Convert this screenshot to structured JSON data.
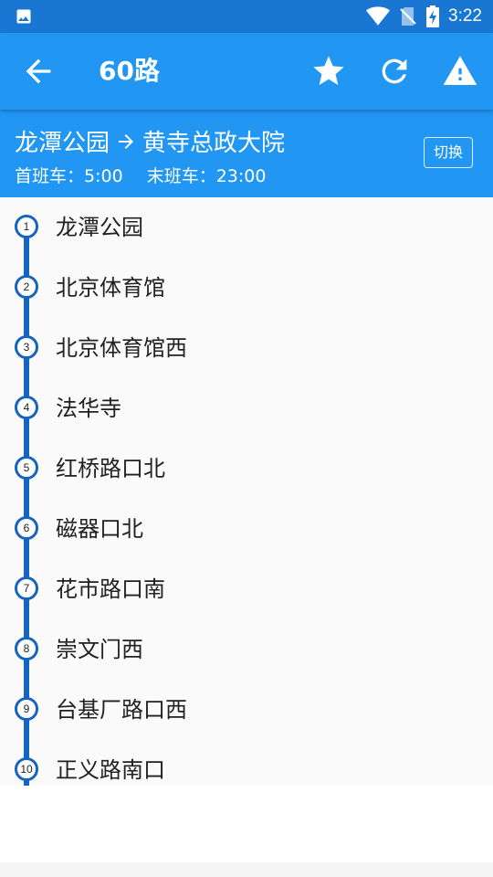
{
  "status_bar": {
    "time": "3:22"
  },
  "app_bar": {
    "title": "60路"
  },
  "route": {
    "from": "龙潭公园",
    "to": "黄寺总政大院",
    "first_bus": "首班车：5:00",
    "last_bus": "末班车：23:00",
    "switch_label": "切换"
  },
  "stops": [
    {
      "num": "1",
      "name": "龙潭公园"
    },
    {
      "num": "2",
      "name": "北京体育馆"
    },
    {
      "num": "3",
      "name": "北京体育馆西"
    },
    {
      "num": "4",
      "name": "法华寺"
    },
    {
      "num": "5",
      "name": "红桥路口北"
    },
    {
      "num": "6",
      "name": "磁器口北"
    },
    {
      "num": "7",
      "name": "花市路口南"
    },
    {
      "num": "8",
      "name": "崇文门西"
    },
    {
      "num": "9",
      "name": "台基厂路口西"
    },
    {
      "num": "10",
      "name": "正义路南口"
    }
  ],
  "colors": {
    "status_bar": "#1976D2",
    "primary": "#2196F3",
    "line": "#1565C0"
  },
  "icons": [
    "image-icon",
    "wifi-icon",
    "no-sim-icon",
    "battery-charging-icon",
    "back-arrow-icon",
    "star-icon",
    "refresh-icon",
    "warning-icon"
  ]
}
